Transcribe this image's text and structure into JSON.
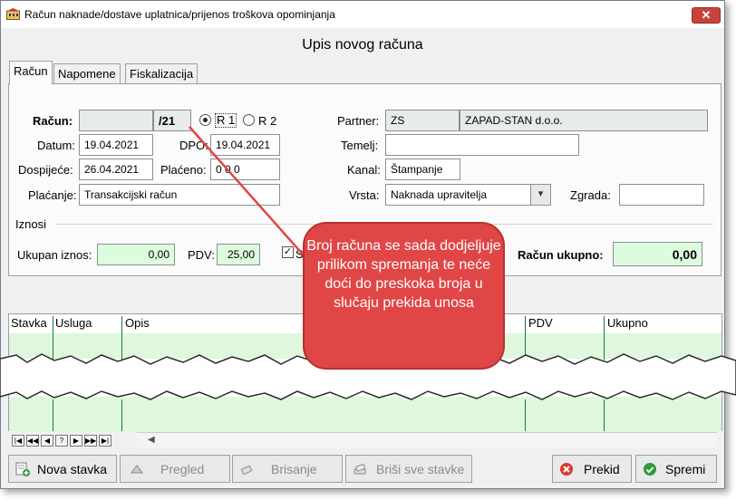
{
  "window": {
    "title": "Račun naknade/dostave uplatnica/prijenos troškova opominjanja",
    "heading": "Upis novog računa",
    "close_glyph": "✕"
  },
  "tabs": [
    "Račun",
    "Napomene",
    "Fiskalizacija"
  ],
  "form": {
    "racun_label": "Račun:",
    "racun_value": "",
    "racun_suffix": "/21",
    "r1_label": "R 1",
    "r2_label": "R 2",
    "r1_selected": true,
    "datum_label": "Datum:",
    "datum_value": "19.04.2021",
    "dpo_label": "DPO:",
    "dpo_value": "19.04.2021",
    "dospijece_label": "Dospijeće:",
    "dospijece_value": "26.04.2021",
    "placeno_label": "Plaćeno:",
    "placeno_value": "0 0 0",
    "placanje_label": "Plaćanje:",
    "placanje_value": "Transakcijski račun",
    "partner_label": "Partner:",
    "partner_code": "ZS",
    "partner_name": "ZAPAD-STAN d.o.o.",
    "temelj_label": "Temelj:",
    "temelj_value": "",
    "kanal_label": "Kanal:",
    "kanal_value": "Štampanje",
    "vrsta_label": "Vrsta:",
    "vrsta_value": "Naknada upravitelja",
    "zgrada_label": "Zgrada:",
    "zgrada_value": ""
  },
  "amounts": {
    "section_label": "Iznosi",
    "ukupan_label": "Ukupan iznos:",
    "ukupan_value": "0,00",
    "pdv_label": "PDV:",
    "pdv_value": "25,00",
    "pdv_check_label": "S",
    "racun_ukupno_label": "Račun ukupno:",
    "racun_ukupno_value": "0,00"
  },
  "grid": {
    "columns": [
      "Stavka",
      "Usluga",
      "Opis",
      "PDV",
      "Ukupno"
    ]
  },
  "navigator": [
    "|◀",
    "◀◀",
    "◀",
    "?",
    "▶",
    "▶▶",
    "▶|"
  ],
  "buttons": {
    "nova_stavka": "Nova stavka",
    "pregled": "Pregled",
    "brisanje": "Brisanje",
    "brisi_sve": "Briši sve stavke",
    "prekid": "Prekid",
    "spremi": "Spremi"
  },
  "callout": {
    "text": "Broj računa se sada dodjeljuje prilikom spremanja te neće doći do preskoka broja u slučaju prekida unosa",
    "color": "#e04646"
  },
  "colors": {
    "accent_green": "#ddfbdd",
    "close_red": "#c8443a"
  }
}
